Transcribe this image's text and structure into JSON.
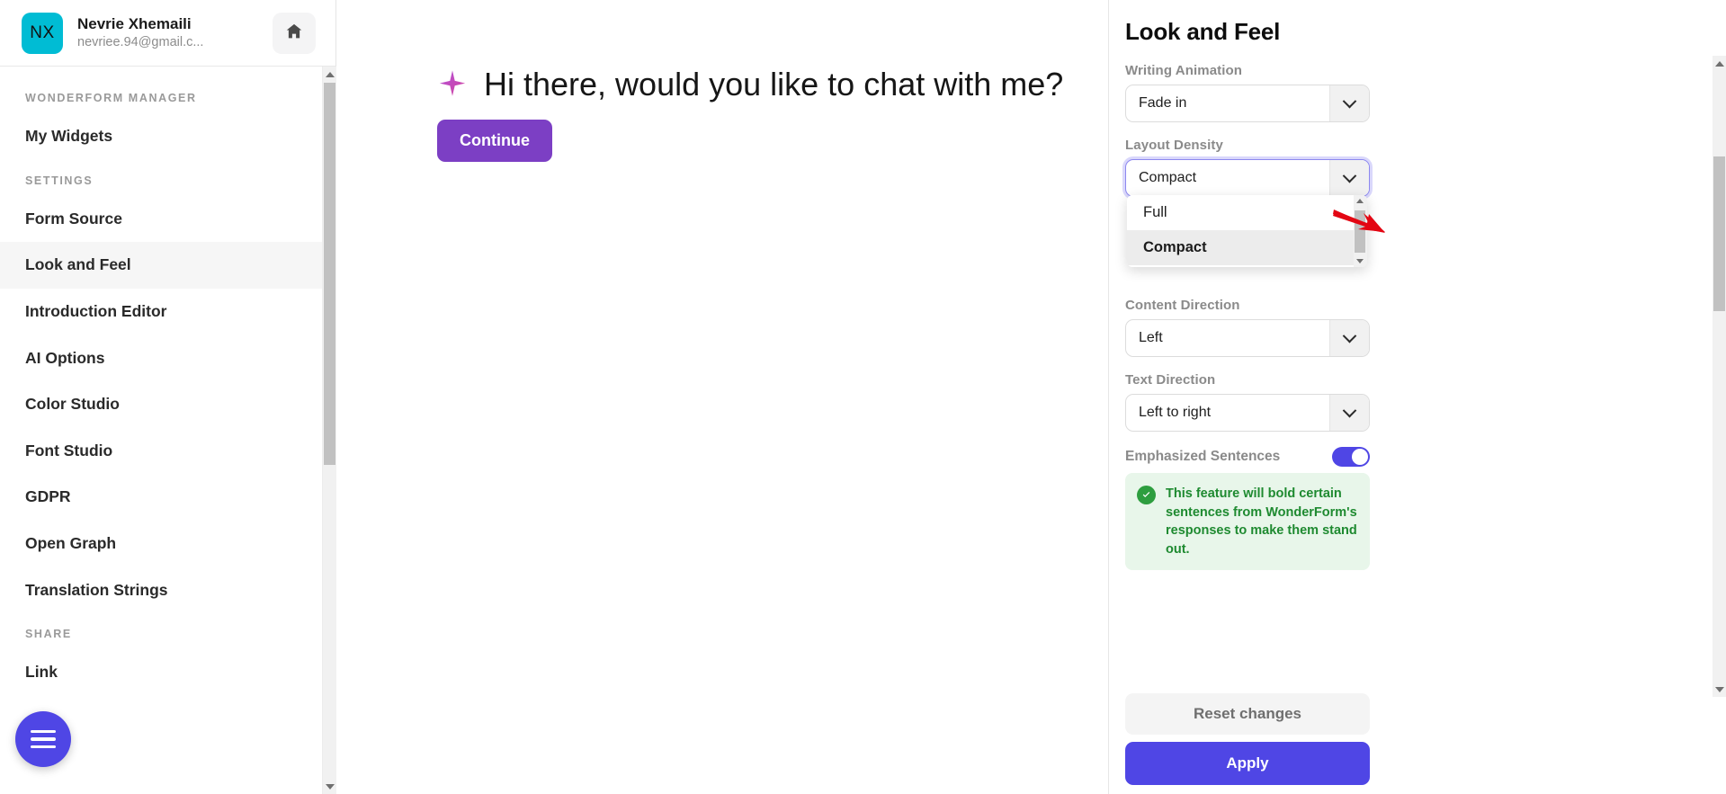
{
  "sidebar": {
    "user": {
      "initials": "NX",
      "name": "Nevrie Xhemaili",
      "email": "nevriee.94@gmail.c...",
      "home_icon": "home-icon"
    },
    "sections": [
      {
        "label": "WONDERFORM MANAGER",
        "items": [
          {
            "label": "My Widgets",
            "active": false
          }
        ]
      },
      {
        "label": "SETTINGS",
        "items": [
          {
            "label": "Form Source",
            "active": false
          },
          {
            "label": "Look and Feel",
            "active": true
          },
          {
            "label": "Introduction Editor",
            "active": false
          },
          {
            "label": "AI Options",
            "active": false
          },
          {
            "label": "Color Studio",
            "active": false
          },
          {
            "label": "Font Studio",
            "active": false
          },
          {
            "label": "GDPR",
            "active": false
          },
          {
            "label": "Open Graph",
            "active": false
          },
          {
            "label": "Translation Strings",
            "active": false
          }
        ]
      },
      {
        "label": "SHARE",
        "items": [
          {
            "label": "Link",
            "active": false
          }
        ]
      }
    ],
    "menu_fab": "hamburger-menu-icon"
  },
  "main": {
    "sparkle_icon": "sparkle-icon",
    "greeting": "Hi there, would you like to chat with me?",
    "continue_label": "Continue"
  },
  "panel": {
    "title": "Look and Feel",
    "fields": [
      {
        "label": "Writing Animation",
        "value": "Fade in"
      },
      {
        "label": "Layout Density",
        "value": "Compact"
      },
      {
        "label": "Content Direction",
        "value": "Left"
      },
      {
        "label": "Text Direction",
        "value": "Left to right"
      }
    ],
    "dropdown": {
      "open": true,
      "options": [
        {
          "label": "Full",
          "selected": false
        },
        {
          "label": "Compact",
          "selected": true
        }
      ]
    },
    "toggle": {
      "label": "Emphasized Sentences",
      "state": "on"
    },
    "notice": {
      "icon": "check-circle-icon",
      "text": "This feature will bold certain sentences from WonderForm's responses to make them stand out."
    },
    "footer": {
      "reset_label": "Reset changes",
      "apply_label": "Apply"
    }
  },
  "colors": {
    "accent": "#4f46e5",
    "continue_button": "#7c3fc4",
    "avatar": "#00bcd4",
    "notice_text": "#1e8a30",
    "notice_bg": "#e8f6ea",
    "annotation_arrow": "#e30613"
  }
}
